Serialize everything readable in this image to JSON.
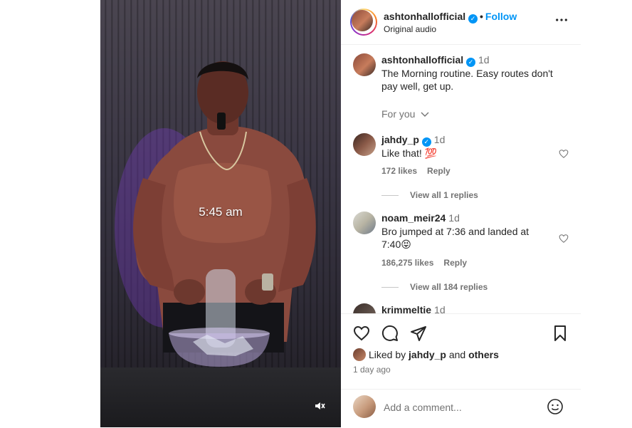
{
  "media": {
    "overlay_text": "5:45 am",
    "mute_icon": "speaker-muted-icon"
  },
  "header": {
    "username": "ashtonhallofficial",
    "verified_icon": "verified-badge-icon",
    "separator": "•",
    "follow_label": "Follow",
    "audio_label": "Original audio",
    "more_icon": "more-options-icon"
  },
  "caption": {
    "username": "ashtonhallofficial",
    "time": "1d",
    "text": "The Morning routine. Easy routes don't pay well, get up.",
    "for_you": "For you"
  },
  "comments": [
    {
      "username": "jahdy_p",
      "verified": true,
      "time": "1d",
      "text": "Like that! 💯",
      "likes": "172 likes",
      "reply_label": "Reply",
      "view_replies": "View all 1 replies"
    },
    {
      "username": "noam_meir24",
      "verified": false,
      "time": "1d",
      "text": "Bro jumped at 7:36 and landed at 7:40😝",
      "likes": "186,275 likes",
      "reply_label": "Reply",
      "view_replies": "View all 184 replies"
    },
    {
      "username": "krimmeltie",
      "verified": false,
      "time": "1d"
    }
  ],
  "actions": {
    "like_icon": "heart-icon",
    "comment_icon": "comment-icon",
    "share_icon": "share-icon",
    "save_icon": "bookmark-icon",
    "liked_by_prefix": "Liked by",
    "liked_by_user": "jahdy_p",
    "liked_by_and": "and",
    "liked_by_others": "others",
    "posted_ago": "1 day ago"
  },
  "add_comment": {
    "placeholder": "Add a comment...",
    "emoji_icon": "emoji-icon"
  }
}
